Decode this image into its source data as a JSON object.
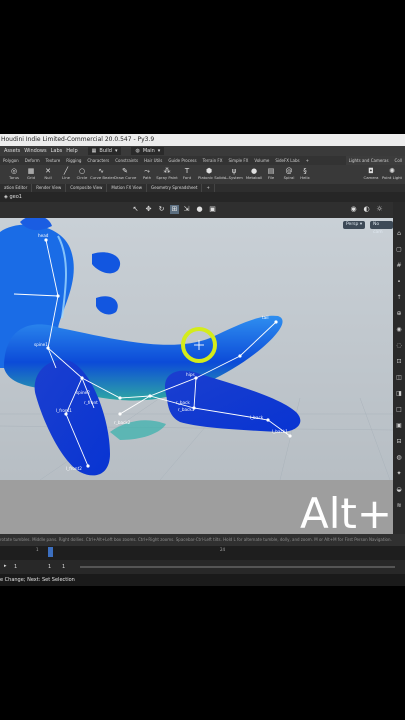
{
  "window": {
    "title": "Houdini Indie Limited-Commercial 20.0.547 - Py3.9"
  },
  "menu": {
    "items": [
      "Assets",
      "Windows",
      "Labs",
      "Help"
    ],
    "desktop": "Build",
    "context": "Main"
  },
  "shelf_tabs": [
    "Polygon",
    "Deform",
    "Texture",
    "Rigging",
    "Characters",
    "Constraints",
    "Hair Utils",
    "Guide Process",
    "Terrain FX",
    "Simple FX",
    "Volume",
    "SideFX Labs"
  ],
  "shelf_tabs_right": [
    "Lights and Cameras",
    "Coll"
  ],
  "tools": [
    {
      "icon": "torus-icon",
      "label": "Torus"
    },
    {
      "icon": "grid-icon",
      "label": "Grid"
    },
    {
      "icon": "null-icon",
      "label": "Null"
    },
    {
      "icon": "line-icon",
      "label": "Line"
    },
    {
      "icon": "circle-icon",
      "label": "Circle"
    },
    {
      "icon": "curve-bezier-icon",
      "label": "Curve Bezier"
    },
    {
      "icon": "draw-curve-icon",
      "label": "Draw Curve"
    },
    {
      "icon": "path-icon",
      "label": "Path"
    },
    {
      "icon": "spray-paint-icon",
      "label": "Spray Paint"
    },
    {
      "icon": "font-icon",
      "label": "Font"
    },
    {
      "icon": "platonic-solids-icon",
      "label": "Platonic Solids"
    },
    {
      "icon": "l-system-icon",
      "label": "L-System"
    },
    {
      "icon": "metaball-icon",
      "label": "Metaball"
    },
    {
      "icon": "file-icon",
      "label": "File"
    },
    {
      "icon": "spiral-icon",
      "label": "Spiral"
    },
    {
      "icon": "helix-icon",
      "label": "Helix"
    }
  ],
  "tools_right": [
    {
      "icon": "camera-icon",
      "label": "Camera"
    },
    {
      "icon": "point-light-icon",
      "label": "Point Light"
    }
  ],
  "pane_tabs": [
    "ation Editor",
    "Render View",
    "Composite View",
    "Motion FX View",
    "Geometry Spreadsheet"
  ],
  "path": {
    "node": "geo1"
  },
  "viewport": {
    "camera": "Persp",
    "display": "No cam"
  },
  "joints": [
    {
      "name": "head"
    },
    {
      "name": "neck"
    },
    {
      "name": "spine1"
    },
    {
      "name": "spine2"
    },
    {
      "name": "hips"
    },
    {
      "name": "tail"
    },
    {
      "name": "r_front"
    },
    {
      "name": "l_front1"
    },
    {
      "name": "l_front2"
    },
    {
      "name": "r_back"
    },
    {
      "name": "r_back1"
    },
    {
      "name": "r_back2"
    },
    {
      "name": "l_back"
    },
    {
      "name": "l_back1"
    }
  ],
  "overlay_text": "Alt+",
  "status_hint": "rotate tumbles. Middle pans. Right dollies. Ctrl+Alt+Left box zooms. Ctrl+Right zooms. Spacebar-Ctrl-Left tilts. Hold L for alternate tumble, dolly, and zoom. M or Alt+M for First Person Navigation.",
  "timeline": {
    "start_frame": "1",
    "end_frame": "1",
    "ticks": [
      "1",
      "24"
    ]
  },
  "help": {
    "text": "e Change; Next: Set Selection"
  },
  "colors": {
    "body": "#0a49d6",
    "highlight": "#3fa9f5",
    "belly": "#2fb0a8",
    "skeleton": "#ffffff",
    "ring": "#d4ec1a",
    "viewport": "#c4cbd1"
  }
}
